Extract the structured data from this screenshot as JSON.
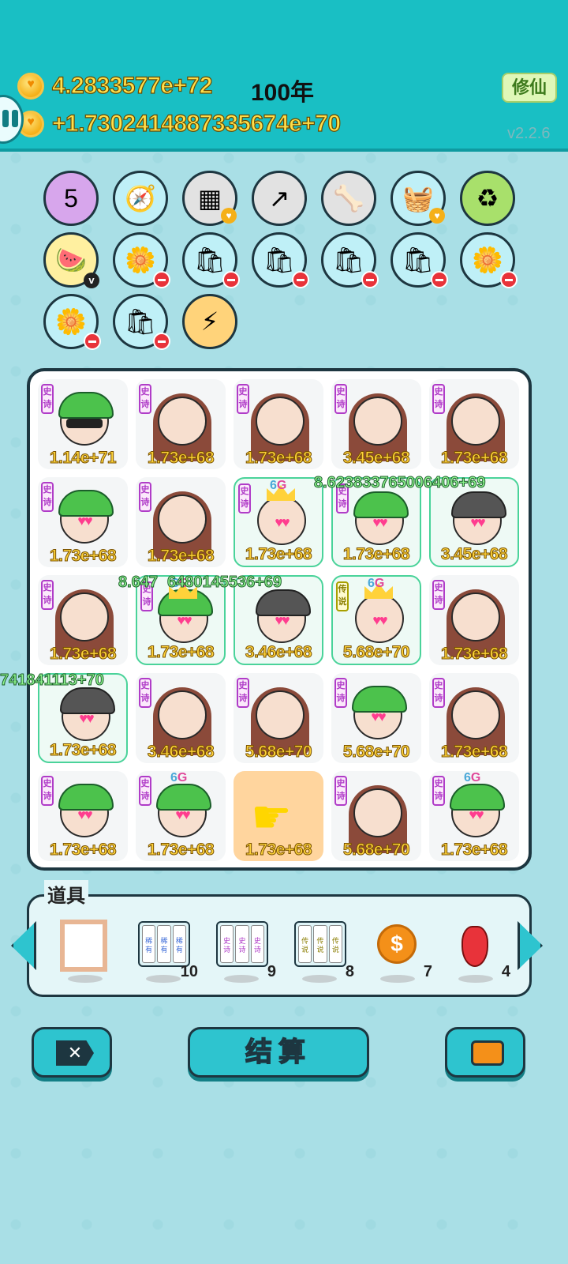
{
  "header": {
    "money": "4.2833577e+72",
    "years": "100年",
    "rate": "+1.7302414887335674e+70",
    "xiuxian_label": "修仙",
    "version": "v2.2.6"
  },
  "icons": [
    {
      "name": "calendar-icon",
      "glyph": "5",
      "style": "lilac"
    },
    {
      "name": "compass-icon",
      "glyph": "🧭",
      "style": ""
    },
    {
      "name": "cubes-icon",
      "glyph": "▦",
      "style": "grey"
    },
    {
      "name": "arrow-up-icon",
      "glyph": "↗",
      "style": "grey"
    },
    {
      "name": "bone-bowl-icon",
      "glyph": "🦴",
      "style": "grey"
    },
    {
      "name": "fruit-basket-icon",
      "glyph": "🧺",
      "style": ""
    },
    {
      "name": "recycle-icon",
      "glyph": "♻",
      "style": "green"
    },
    {
      "name": "fruit-plate-icon",
      "glyph": "🍉",
      "style": "yellow"
    },
    {
      "name": "flower-pot-icon",
      "glyph": "🌼",
      "style": ""
    },
    {
      "name": "sack-icon",
      "glyph": "🛍",
      "style": ""
    },
    {
      "name": "sack-icon",
      "glyph": "🛍",
      "style": ""
    },
    {
      "name": "sack-icon",
      "glyph": "🛍",
      "style": ""
    },
    {
      "name": "sack-icon",
      "glyph": "🛍",
      "style": ""
    },
    {
      "name": "flower-pot-icon",
      "glyph": "🌼",
      "style": ""
    },
    {
      "name": "flower-pot-icon",
      "glyph": "🌼",
      "style": ""
    },
    {
      "name": "sack-icon",
      "glyph": "🛍",
      "style": ""
    },
    {
      "name": "lightning-icon",
      "glyph": "⚡",
      "style": "orange"
    }
  ],
  "board": {
    "cells": [
      {
        "type": "greenhat-glasses",
        "tag": "史诗",
        "value": "1.14e+71"
      },
      {
        "type": "girl",
        "tag": "史诗",
        "value": "1.73e+68"
      },
      {
        "type": "girl",
        "tag": "史诗",
        "value": "1.73e+68"
      },
      {
        "type": "girl",
        "tag": "史诗",
        "value": "3.45e+68"
      },
      {
        "type": "girl",
        "tag": "史诗",
        "value": "1.73e+68"
      },
      {
        "type": "greenhat-hearts",
        "tag": "史诗",
        "value": "1.73e+68"
      },
      {
        "type": "girl",
        "tag": "史诗",
        "value": "1.73e+68"
      },
      {
        "type": "king",
        "tag": "史诗",
        "value": "1.73e+68",
        "g6": true,
        "glow": true
      },
      {
        "type": "greenhat-hearts",
        "tag": "史诗",
        "value": "1.73e+68",
        "glow": true
      },
      {
        "type": "bowler",
        "tag": "",
        "value": "3.45e+68",
        "glow": true
      },
      {
        "type": "girl",
        "tag": "史诗",
        "value": "1.73e+68"
      },
      {
        "type": "greenhat-king",
        "tag": "史诗",
        "value": "1.73e+68",
        "g6": true,
        "glow": true
      },
      {
        "type": "bowler",
        "tag": "",
        "value": "3.46e+68",
        "glow": true
      },
      {
        "type": "king",
        "tag": "传说",
        "value": "5.68e+70",
        "g6": true,
        "glow": true,
        "legend": true
      },
      {
        "type": "girl",
        "tag": "史诗",
        "value": "1.73e+68"
      },
      {
        "type": "bowler",
        "tag": "",
        "value": "1.73e+68",
        "glow": true
      },
      {
        "type": "girl",
        "tag": "史诗",
        "value": "3.46e+68"
      },
      {
        "type": "girl",
        "tag": "史诗",
        "value": "5.68e+70"
      },
      {
        "type": "greenhat-hearts",
        "tag": "史诗",
        "value": "5.68e+70"
      },
      {
        "type": "girl",
        "tag": "史诗",
        "value": "1.73e+68"
      },
      {
        "type": "greenhat-hearts",
        "tag": "史诗",
        "value": "1.73e+68"
      },
      {
        "type": "greenhat-hearts",
        "tag": "史诗",
        "value": "1.73e+68",
        "g6": true
      },
      {
        "type": "tap",
        "tag": "",
        "value": "1.73e+68"
      },
      {
        "type": "girl",
        "tag": "史诗",
        "value": "5.68e+70"
      },
      {
        "type": "greenhat-hearts",
        "tag": "史诗",
        "value": "1.73e+68",
        "g6": true
      }
    ],
    "floats": [
      "8.623833765006406+69",
      "8.647",
      "6480145536+69",
      "741841113+70"
    ],
    "g6_a": "6",
    "g6_b": "G"
  },
  "tools": {
    "title": "道具",
    "items": [
      {
        "name": "frame",
        "count": ""
      },
      {
        "name": "cards-blue",
        "label": "稀有",
        "count": "10"
      },
      {
        "name": "cards-purple",
        "label": "史诗",
        "count": "9"
      },
      {
        "name": "cards-yellow",
        "label": "传说",
        "count": "8"
      },
      {
        "name": "coin",
        "glyph": "$",
        "count": "7"
      },
      {
        "name": "pepper",
        "count": "4"
      }
    ]
  },
  "buttons": {
    "cancel_glyph": "✕",
    "settle_label": "结算"
  },
  "colors": {
    "header": "#19bfc4",
    "background": "#a9dfe6",
    "value_text": "#ffd43a",
    "float_text": "#8ff58f",
    "button": "#2ec4cf"
  }
}
